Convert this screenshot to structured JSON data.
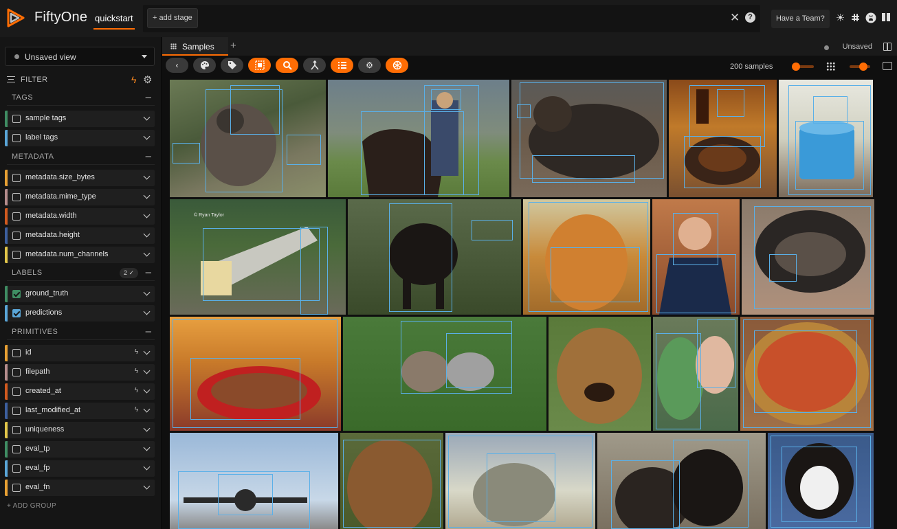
{
  "app": {
    "name": "FiftyOne",
    "dataset": "quickstart"
  },
  "stage_bar": {
    "add_stage_label": "+ add stage"
  },
  "header": {
    "team_label": "Have a Team?"
  },
  "icons": {
    "logo": "fiftyone-logo-icon",
    "clear": "close-icon",
    "help": "help-icon",
    "theme": "sun-icon",
    "slack": "slack-icon",
    "github": "github-icon",
    "docs": "book-icon"
  },
  "colors": {
    "accent": "#ff6d04",
    "box": "#5ab0e8"
  },
  "sidebar": {
    "view_select": "Unsaved view",
    "filter_label": "FILTER",
    "groups": [
      {
        "label": "TAGS"
      },
      {
        "label": "METADATA"
      },
      {
        "label": "LABELS",
        "badge": "2 ✓"
      },
      {
        "label": "PRIMITIVES"
      }
    ],
    "tags": [
      "sample tags",
      "label tags"
    ],
    "metadata": [
      "metadata.size_bytes",
      "metadata.mime_type",
      "metadata.width",
      "metadata.height",
      "metadata.num_channels"
    ],
    "labels": [
      "ground_truth",
      "predictions"
    ],
    "primitives": [
      "id",
      "filepath",
      "created_at",
      "last_modified_at",
      "uniqueness",
      "eval_tp",
      "eval_fp",
      "eval_fn"
    ],
    "add_group": "+ ADD GROUP"
  },
  "main": {
    "tab_label": "Samples",
    "status": "Unsaved",
    "sample_count": "200 samples"
  },
  "grid": {
    "credit_text": "© Ryan Taylor"
  }
}
